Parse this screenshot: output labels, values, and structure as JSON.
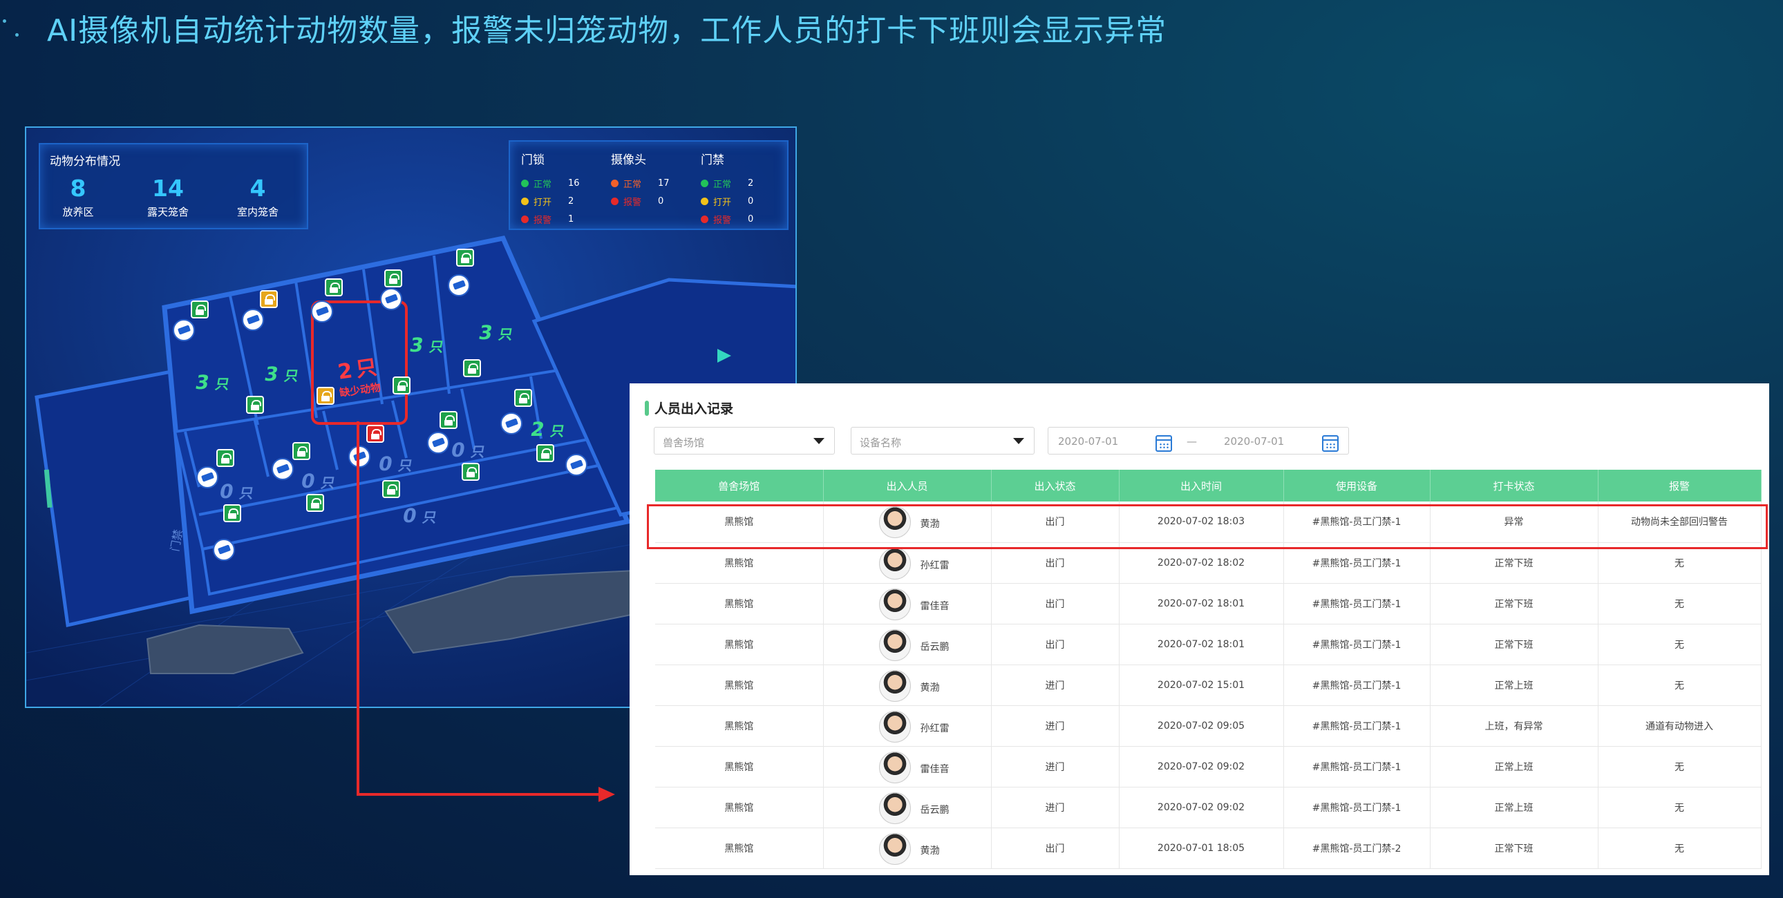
{
  "slide": {
    "title": "AI摄像机自动统计动物数量，报警未归笼动物，工作人员的打卡下班则会显示异常"
  },
  "map": {
    "stats_title": "动物分布情况",
    "stats": [
      {
        "value": "8",
        "label": "放养区"
      },
      {
        "value": "14",
        "label": "露天笼舍"
      },
      {
        "value": "4",
        "label": "室内笼舍"
      }
    ],
    "devices": [
      {
        "title": "门锁",
        "rows": [
          {
            "status": "正常",
            "count": "16",
            "color": "#22c35a"
          },
          {
            "status": "打开",
            "count": "2",
            "color": "#f2c21b"
          },
          {
            "status": "报警",
            "count": "1",
            "color": "#e62a2a"
          }
        ]
      },
      {
        "title": "摄像头",
        "rows": [
          {
            "status": "正常",
            "count": "17",
            "color": "#f2612a"
          },
          {
            "status": "报警",
            "count": "0",
            "color": "#e62a2a"
          }
        ]
      },
      {
        "title": "门禁",
        "rows": [
          {
            "status": "正常",
            "count": "2",
            "color": "#22c35a"
          },
          {
            "status": "打开",
            "count": "0",
            "color": "#f2c21b"
          },
          {
            "status": "报警",
            "count": "0",
            "color": "#e62a2a"
          }
        ]
      }
    ],
    "cage_counts": [
      {
        "num": "3",
        "unit": "只"
      },
      {
        "num": "3",
        "unit": "只"
      },
      {
        "num": "3",
        "unit": "只"
      },
      {
        "num": "3",
        "unit": "只"
      },
      {
        "num": "2",
        "unit": "只"
      },
      {
        "num": "0",
        "unit": "只"
      },
      {
        "num": "0",
        "unit": "只"
      },
      {
        "num": "0",
        "unit": "只"
      },
      {
        "num": "0",
        "unit": "只"
      },
      {
        "num": "0",
        "unit": "只"
      }
    ],
    "missing": {
      "num": "2",
      "unit": "只",
      "note": "缺少动物"
    },
    "gate_label": "门禁"
  },
  "records": {
    "title": "人员出入记录",
    "filter_venue_placeholder": "兽舍场馆",
    "filter_device_placeholder": "设备名称",
    "date_from": "2020-07-01",
    "date_sep": "—",
    "date_to": "2020-07-01",
    "columns": [
      "兽舍场馆",
      "出入人员",
      "出入状态",
      "出入时间",
      "使用设备",
      "打卡状态",
      "报警"
    ],
    "rows": [
      {
        "venue": "黑熊馆",
        "person": "黄渤",
        "state": "出门",
        "time": "2020-07-02   18:03",
        "device": "#黑熊馆-员工门禁-1",
        "punch": "异常",
        "alarm": "动物尚未全部回归警告",
        "punch_red": true,
        "alarm_red": true
      },
      {
        "venue": "黑熊馆",
        "person": "孙红雷",
        "state": "出门",
        "time": "2020-07-02   18:02",
        "device": "#黑熊馆-员工门禁-1",
        "punch": "正常下班",
        "alarm": "无"
      },
      {
        "venue": "黑熊馆",
        "person": "雷佳音",
        "state": "出门",
        "time": "2020-07-02   18:01",
        "device": "#黑熊馆-员工门禁-1",
        "punch": "正常下班",
        "alarm": "无"
      },
      {
        "venue": "黑熊馆",
        "person": "岳云鹏",
        "state": "出门",
        "time": "2020-07-02   18:01",
        "device": "#黑熊馆-员工门禁-1",
        "punch": "正常下班",
        "alarm": "无"
      },
      {
        "venue": "黑熊馆",
        "person": "黄渤",
        "state": "进门",
        "time": "2020-07-02   15:01",
        "device": "#黑熊馆-员工门禁-1",
        "punch": "正常上班",
        "alarm": "无"
      },
      {
        "venue": "黑熊馆",
        "person": "孙红雷",
        "state": "进门",
        "time": "2020-07-02   09:05",
        "device": "#黑熊馆-员工门禁-1",
        "punch": "上班，有异常",
        "alarm": "通道有动物进入",
        "punch_red": true,
        "alarm_red": true
      },
      {
        "venue": "黑熊馆",
        "person": "雷佳音",
        "state": "进门",
        "time": "2020-07-02   09:02",
        "device": "#黑熊馆-员工门禁-1",
        "punch": "正常上班",
        "alarm": "无"
      },
      {
        "venue": "黑熊馆",
        "person": "岳云鹏",
        "state": "进门",
        "time": "2020-07-02   09:02",
        "device": "#黑熊馆-员工门禁-1",
        "punch": "正常上班",
        "alarm": "无"
      },
      {
        "venue": "黑熊馆",
        "person": "黄渤",
        "state": "出门",
        "time": "2020-07-01   18:05",
        "device": "#黑熊馆-员工门禁-2",
        "punch": "正常下班",
        "alarm": "无"
      }
    ]
  },
  "colors": {
    "title": "#5fd1f7",
    "table_header": "#5ccf93",
    "alert": "#e8292a"
  }
}
